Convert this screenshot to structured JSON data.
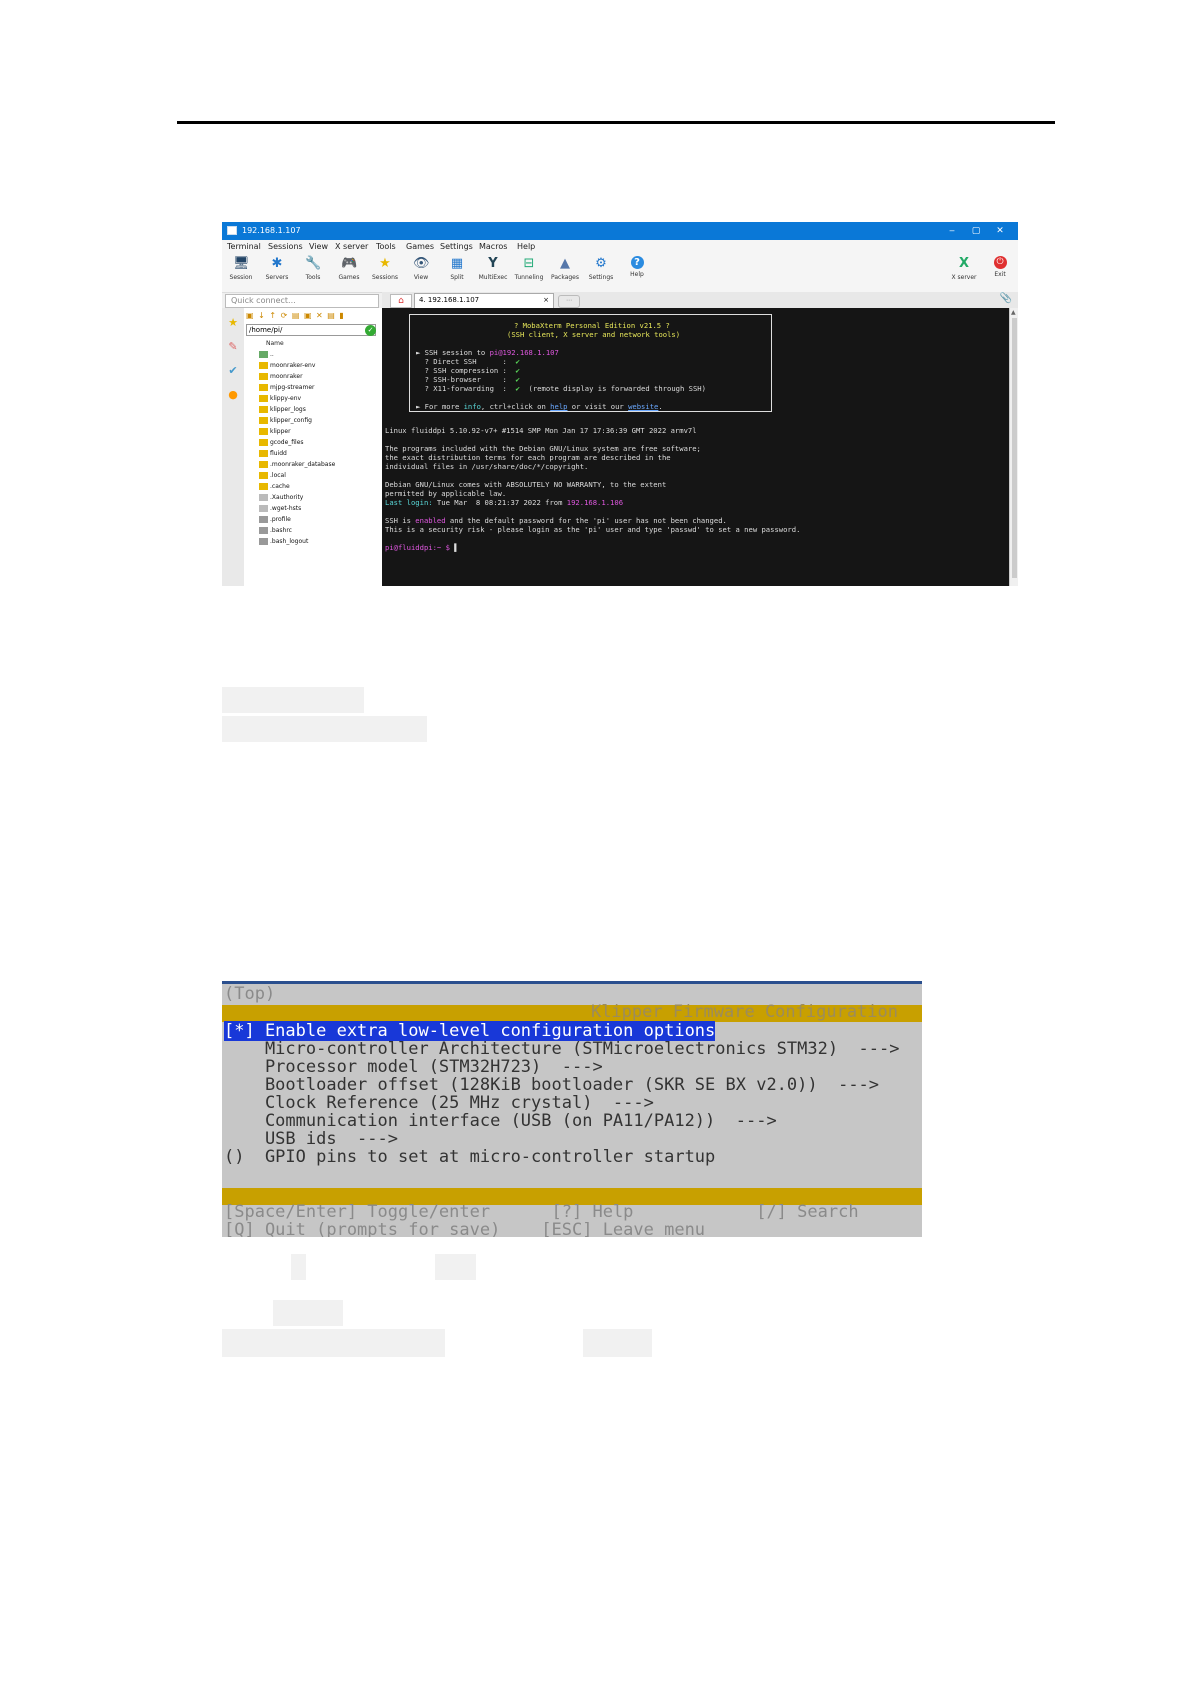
{
  "moba": {
    "window_title": "192.168.1.107",
    "win_min": "‒",
    "win_max": "▢",
    "win_close": "✕",
    "menu": [
      "Terminal",
      "Sessions",
      "View",
      "X server",
      "Tools",
      "Games",
      "Settings",
      "Macros",
      "Help"
    ],
    "toolbar": [
      {
        "label": "Session",
        "icon": "🖥"
      },
      {
        "label": "Servers",
        "icon": "✱"
      },
      {
        "label": "Tools",
        "icon": "🔧"
      },
      {
        "label": "Games",
        "icon": "🎮"
      },
      {
        "label": "Sessions",
        "icon": "★"
      },
      {
        "label": "View",
        "icon": "👁"
      },
      {
        "label": "Split",
        "icon": "▦"
      },
      {
        "label": "MultiExec",
        "icon": "Y"
      },
      {
        "label": "Tunneling",
        "icon": "⊟"
      },
      {
        "label": "Packages",
        "icon": "▲"
      },
      {
        "label": "Settings",
        "icon": "⚙"
      },
      {
        "label": "Help",
        "icon": "?"
      }
    ],
    "xserver_label": "X server",
    "xserver_icon": "X",
    "exit_label": "Exit",
    "exit_icon": "⏻",
    "quick_connect_placeholder": "Quick connect...",
    "home_tab_icon": "⌂",
    "ssh_tab_label": "4. 192.168.1.107",
    "ssh_tab_close": "×",
    "new_tab_icon": "⋯",
    "attach_icon": "📎",
    "side_icons": [
      "★",
      "✎",
      "✔",
      "●"
    ],
    "sftp_toolbar_icons": "▣ ↓ ↑ ⟳ ▤ ▣ ✕ ▤ ▮",
    "sftp_path": "/home/pi/",
    "sftp_path_ok": "✓",
    "sftp_column": "Name",
    "sftp_files": [
      {
        "name": "..",
        "kind": "up"
      },
      {
        "name": "moonraker-env",
        "kind": "folder"
      },
      {
        "name": "moonraker",
        "kind": "folder"
      },
      {
        "name": "mjpg-streamer",
        "kind": "folder"
      },
      {
        "name": "klippy-env",
        "kind": "folder"
      },
      {
        "name": "klipper_logs",
        "kind": "folder"
      },
      {
        "name": "klipper_config",
        "kind": "folder"
      },
      {
        "name": "klipper",
        "kind": "folder"
      },
      {
        "name": "gcode_files",
        "kind": "folder"
      },
      {
        "name": "fluidd",
        "kind": "folder"
      },
      {
        "name": ".moonraker_database",
        "kind": "folder"
      },
      {
        "name": ".local",
        "kind": "folder"
      },
      {
        "name": ".cache",
        "kind": "folder"
      },
      {
        "name": ".Xauthority",
        "kind": "file"
      },
      {
        "name": ".wget-hsts",
        "kind": "file"
      },
      {
        "name": ".profile",
        "kind": "file2"
      },
      {
        "name": ".bashrc",
        "kind": "file2"
      },
      {
        "name": ".bash_logout",
        "kind": "file2"
      }
    ],
    "terminal": {
      "banner_title": "? MobaXterm Personal Edition v21.5 ?",
      "banner_sub": "(SSH client, X server and network tools)",
      "ssh_session_prefix": "► SSH session to ",
      "ssh_host": "pi@192.168.1.107",
      "direct_ssh": "  ? Direct SSH      :  ",
      "ssh_compression": "  ? SSH compression :  ",
      "ssh_browser": "  ? SSH-browser     :  ",
      "x11_forwarding": "  ? X11-forwarding  :  ",
      "x11_note": "  (remote display is forwarded through SSH)",
      "check": "✔",
      "more_info_1": "► For more ",
      "more_info_info": "info",
      "more_info_2": ", ctrl+click on ",
      "more_info_help": "help",
      "more_info_3": " or visit our ",
      "more_info_site": "website",
      "more_info_4": ".",
      "uname": "Linux fluiddpi 5.10.92-v7+ #1514 SMP Mon Jan 17 17:36:39 GMT 2022 armv7l",
      "motd1": "The programs included with the Debian GNU/Linux system are free software;",
      "motd2": "the exact distribution terms for each program are described in the",
      "motd3": "individual files in /usr/share/doc/*/copyright.",
      "motd4": "Debian GNU/Linux comes with ABSOLUTELY NO WARRANTY, to the extent",
      "motd5": "permitted by applicable law.",
      "last_login_label": "Last login:",
      "last_login_text": " Tue Mar  8 08:21:37 2022 from ",
      "last_login_ip": "192.168.1.106",
      "ssh_warn_1": "SSH is ",
      "ssh_warn_enabled": "enabled",
      "ssh_warn_2": " and the default password for the 'pi' user has not been changed.",
      "ssh_warn_3": "This is a security risk - please login as the 'pi' user and type 'passwd' to set a new password.",
      "prompt": "pi@fluiddpi:~ $ ",
      "cursor": "▌"
    }
  },
  "klipper": {
    "top_label": "(Top)",
    "title": "Klipper Firmware Configuration",
    "selected_line": "[*] Enable extra low-level configuration options",
    "lines": [
      "    Micro-controller Architecture (STMicroelectronics STM32)  --->",
      "    Processor model (STM32H723)  --->",
      "    Bootloader offset (128KiB bootloader (SKR SE BX v2.0))  --->",
      "    Clock Reference (25 MHz crystal)  --->",
      "    Communication interface (USB (on PA11/PA12))  --->",
      "    USB ids  --->",
      "()  GPIO pins to set at micro-controller startup"
    ],
    "footer1": "[Space/Enter] Toggle/enter      [?] Help            [/] Search",
    "footer2": "[Q] Quit (prompts for save)    [ESC] Leave menu"
  }
}
